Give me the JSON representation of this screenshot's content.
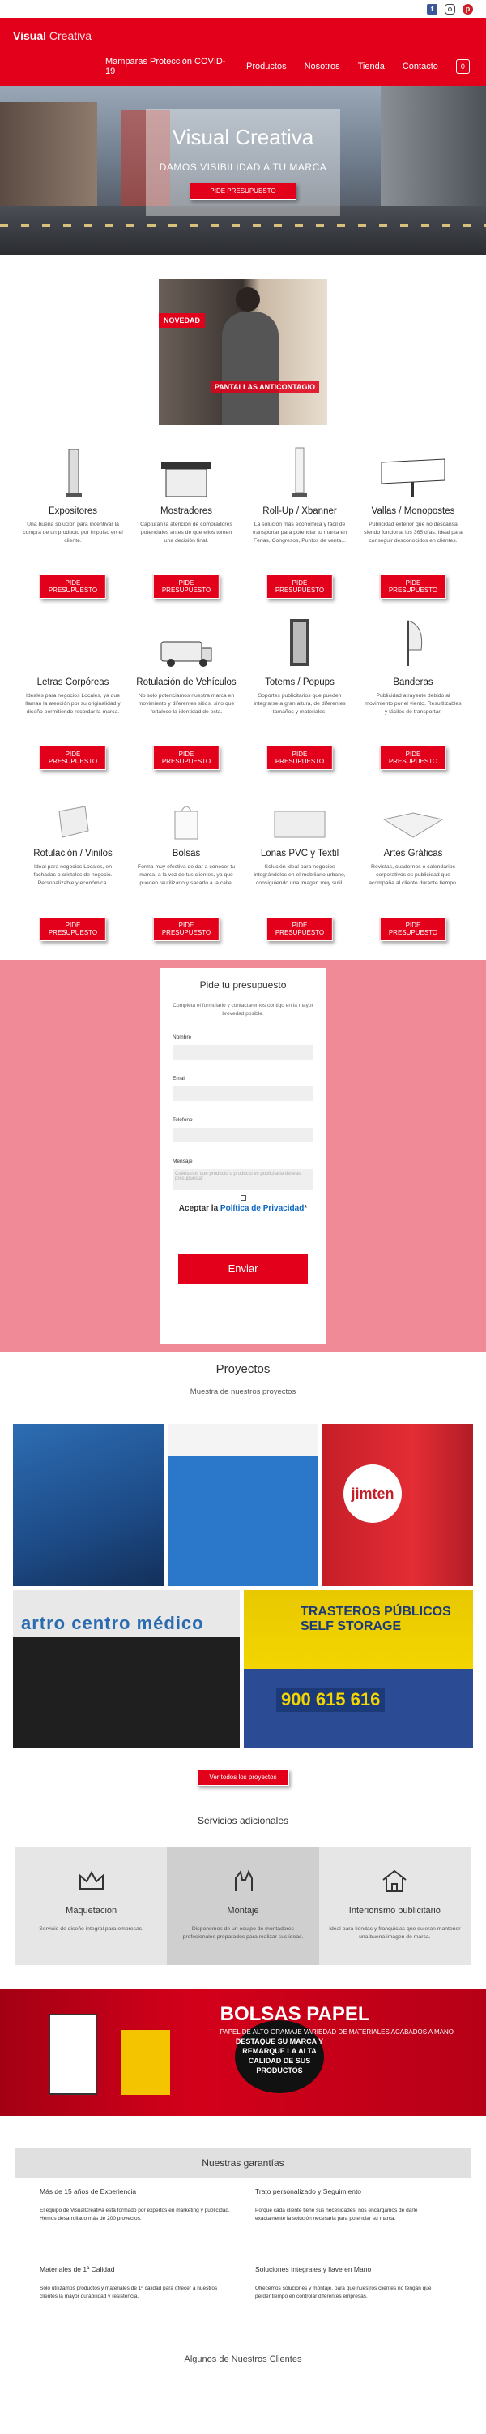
{
  "brand": {
    "name_bold": "Visual",
    "name_light": "Creativa",
    "accent": "#e2001a"
  },
  "nav": {
    "items": [
      "Mamparas Protección COVID-19",
      "Productos",
      "Nosotros",
      "Tienda",
      "Contacto"
    ],
    "cart_count": "0"
  },
  "hero": {
    "title": "Visual Creativa",
    "subtitle": "DAMOS VISIBILIDAD A TU MARCA",
    "cta": "PIDE PRESUPUESTO"
  },
  "promo": {
    "tag": "NOVEDAD",
    "caption": "PANTALLAS ANTICONTAGIO"
  },
  "products": [
    {
      "title": "Expositores",
      "desc": "Una buena solución para incentivar la compra de un producto por impulso en el cliente.",
      "cta": "PIDE PRESUPUESTO"
    },
    {
      "title": "Mostradores",
      "desc": "Capturan la atención de compradores potenciales antes de que ellos tomen una decisión final.",
      "cta": "PIDE PRESUPUESTO"
    },
    {
      "title": "Roll-Up / Xbanner",
      "desc": "La solución más económica y fácil de transportar para potenciar tu marca en Ferias, Congresos, Puntos de venta...",
      "cta": "PIDE PRESUPUESTO"
    },
    {
      "title": "Vallas / Monopostes",
      "desc": "Publicidad exterior que no descansa siendo funcional los 365 días. Ideal para conseguir desconocidos en clientes.",
      "cta": "PIDE PRESUPUESTO"
    },
    {
      "title": "Letras Corpóreas",
      "desc": "Ideales para negocios Locales, ya que llaman la atención por su originalidad y diseño permitiendo recordar la marca.",
      "cta": "PIDE PRESUPUESTO"
    },
    {
      "title": "Rotulación de Vehículos",
      "desc": "No solo potenciamos nuestra marca en movimiento y diferentes sitios, sino que fortalece la identidad de esta.",
      "cta": "PIDE PRESUPUESTO"
    },
    {
      "title": "Totems / Popups",
      "desc": "Soportes publicitarios que pueden integrarse a gran altura, de diferentes tamaños y materiales.",
      "cta": "PIDE PRESUPUESTO"
    },
    {
      "title": "Banderas",
      "desc": "Publicidad atrayente debido al movimiento por el viento. Resultlizables y fáciles de transportar.",
      "cta": "PIDE PRESUPUESTO"
    },
    {
      "title": "Rotulación / Vinilos",
      "desc": "Ideal para negocios Locales, en fachadas o cristales de negocio. Personalizable y económica.",
      "cta": "PIDE PRESUPUESTO"
    },
    {
      "title": "Bolsas",
      "desc": "Forma muy efectiva de dar a conocer tu marca, a la vez de tus clientes, ya que pueden reutilizarlo y sacarlo a la calle.",
      "cta": "PIDE PRESUPUESTO"
    },
    {
      "title": "Lonas PVC y Textil",
      "desc": "Solución ideal para negocios integrándolos en el mobiliario urbano, consiguiendo una imagen muy sutil.",
      "cta": "PIDE PRESUPUESTO"
    },
    {
      "title": "Artes Gráficas",
      "desc": "Revistas, cuadernos o calendarios corporativos es publicidad que acompaña al cliente durante tiempo.",
      "cta": "PIDE PRESUPUESTO"
    }
  ],
  "form": {
    "title": "Pide tu presupuesto",
    "intro": "Completa el formulario y contactaremos contigo en la mayor brevedad posible.",
    "name_label": "Nombre",
    "email_label": "Email",
    "phone_label": "Teléfono",
    "message_label": "Mensaje",
    "message_placeholder": "Cuéntanos que producto o producto es publicitaria deseas presupuestar",
    "privacy_prefix": "Aceptar la",
    "privacy_link": "Política de Privacidad",
    "privacy_required": "*",
    "submit": "Enviar"
  },
  "projects": {
    "title": "Proyectos",
    "subtitle": "Muestra de nuestros proyectos",
    "jimten": "jimten",
    "medical": "artro centro médico",
    "trasteros": "TRASTEROS PÚBLICOS SELF STORAGE",
    "phone": "900 615 616",
    "cta": "Ver todos los proyectos"
  },
  "services": {
    "title": "Servicios adicionales",
    "items": [
      {
        "title": "Maquetación",
        "desc": "Servicio de diseño integral para empresas."
      },
      {
        "title": "Montaje",
        "desc": "Disponemos de un equipo de montadores profesionales preparados para realizar sus ideas."
      },
      {
        "title": "Interiorismo publicitario",
        "desc": "Ideal para tiendas y franquicias que quieran mantener una buena imagen de marca."
      }
    ]
  },
  "banner": {
    "badge": "DESTAQUE SU MARCA Y REMARQUE LA ALTA CALIDAD DE SUS PRODUCTOS",
    "big": "BOLSAS PAPEL",
    "small": "PAPEL DE ALTO GRAMAJE VARIEDAD DE MATERIALES ACABADOS A MANO"
  },
  "guarantees": {
    "title": "Nuestras garantías",
    "items": [
      {
        "title": "Más de 15 años de Experiencia",
        "desc": "El equipo de VisualCreativa está formado por expertos en marketing y publicidad. Hemos desarrollado más de 200 proyectos."
      },
      {
        "title": "Trato personalizado y Seguimiento",
        "desc": "Porque cada cliente tiene sus necesidades, nos encargamos de darle exactamente la solución necesaria para potenciar su marca."
      },
      {
        "title": "Materiales de 1ª Calidad",
        "desc": "Sólo utilizamos productos y materiales de 1ª calidad para ofrecer a nuestros clientes la mayor durabilidad y resistencia."
      },
      {
        "title": "Soluciones Integrales y llave en Mano",
        "desc": "Ofrecemos soluciones y montaje, para que nuestros clientes no tengan que perder tiempo en controlar diferentes empresas."
      }
    ]
  },
  "clients": {
    "title": "Algunos de Nuestros Clientes"
  }
}
